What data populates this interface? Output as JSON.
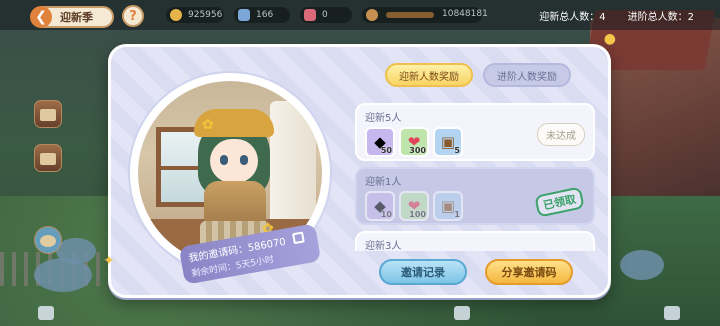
{
  "topbar": {
    "back_label": "迎新季",
    "help_label": "?",
    "resources": [
      {
        "icon": "coin-icon",
        "value": "925956"
      },
      {
        "icon": "gem-icon",
        "value": "166"
      },
      {
        "icon": "ticket-icon",
        "value": "0"
      },
      {
        "icon": "bear-icon",
        "value": ""
      },
      {
        "icon": "level-bar-icon",
        "value": "10848181"
      }
    ],
    "stats": {
      "new_total": "迎新总人数：4",
      "advanced_total": "进阶总人数：2"
    }
  },
  "portrait": {
    "code_line": "我的邀请码：586070",
    "time_line": "剩余时间：5天5小时"
  },
  "tabs": [
    {
      "label": "迎新人数奖励",
      "active": true
    },
    {
      "label": "进阶人数奖励",
      "active": false
    }
  ],
  "rewards": [
    {
      "title": "迎新5人",
      "items": [
        {
          "icon": "crystal-icon",
          "qty": "50"
        },
        {
          "icon": "heart-icon",
          "qty": "300"
        },
        {
          "icon": "treasure-chest-icon",
          "qty": "5"
        }
      ],
      "status": "未达成"
    },
    {
      "title": "迎新1人",
      "items": [
        {
          "icon": "crystal-icon",
          "qty": "10"
        },
        {
          "icon": "heart-icon",
          "qty": "100"
        },
        {
          "icon": "treasure-chest-icon",
          "qty": "1"
        }
      ],
      "status": "已领取"
    },
    {
      "title": "迎新3人"
    }
  ],
  "buttons": {
    "records": "邀请记录",
    "share": "分享邀请码"
  }
}
